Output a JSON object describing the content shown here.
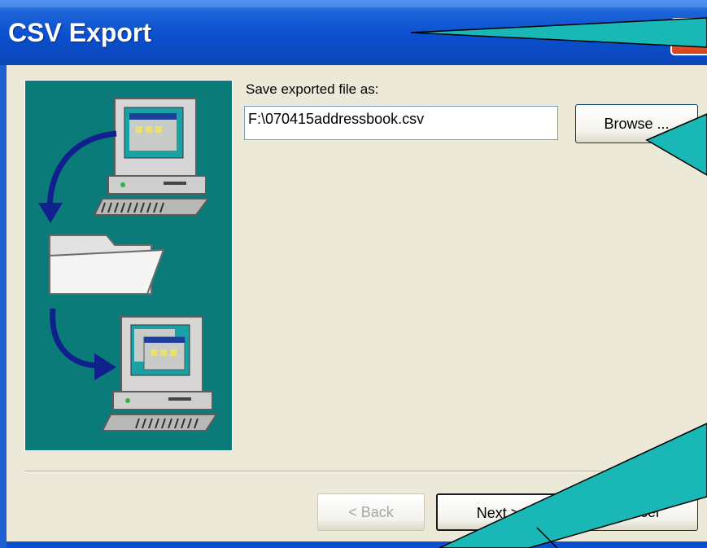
{
  "window": {
    "title": "CSV Export",
    "close_glyph": "✕"
  },
  "form": {
    "prompt_label": "Save exported file as:",
    "file_path": "F:\\070415addressbook.csv",
    "browse_label": "Browse ..."
  },
  "buttons": {
    "back": "< Back",
    "next": "Next >",
    "cancel": "Cancel"
  },
  "colors": {
    "title_bar": "#0a4fcf",
    "dialog_bg": "#ece9d8",
    "art_bg": "#0b7b7a",
    "callout": "#1ab7b7"
  }
}
